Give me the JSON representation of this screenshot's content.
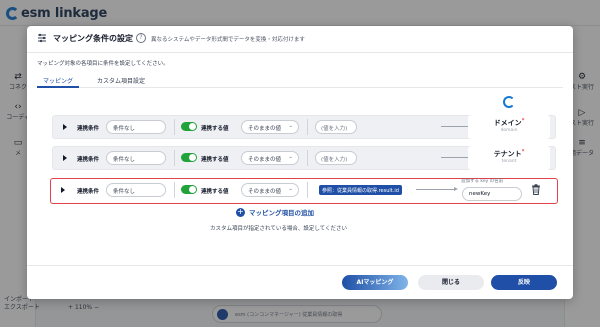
{
  "app": {
    "logo_text": "esm linkage",
    "back_label": "Se",
    "left_panel": [
      {
        "label": "コネク",
        "icon": "link-icon"
      },
      {
        "label": "コーディ",
        "icon": "code-icon"
      },
      {
        "label": "メ",
        "icon": "message-icon"
      }
    ],
    "right_panel": [
      {
        "label": "スト実行",
        "icon": "gear-icon"
      },
      {
        "label": "スト実行",
        "icon": "play-icon"
      },
      {
        "label": "用データ",
        "icon": "database-icon"
      }
    ],
    "bottom_left": [
      "インポート",
      "エクスポート"
    ],
    "zoom": "110%",
    "bg_node_text": "esm (コンコンマネージャー) 従業員情報の取得"
  },
  "modal": {
    "title": "マッピング条件の設定",
    "subtitle": "異なるシステムやデータ形式間でデータを変換・対応付けます",
    "description": "マッピング対象の各項目に条件を設定してください。",
    "tabs": [
      {
        "label": "マッピング",
        "active": true
      },
      {
        "label": "カスタム項目設定",
        "active": false
      }
    ],
    "rows": [
      {
        "condition_label": "連携条件",
        "condition_value": "条件なし",
        "toggle_on": true,
        "value_label": "連携する値",
        "value_type": "そのままの値",
        "value_placeholder": "(値を入力)",
        "target": "ドメイン",
        "target_sub": "domain"
      },
      {
        "condition_label": "連携条件",
        "condition_value": "条件なし",
        "toggle_on": true,
        "value_label": "連携する値",
        "value_type": "そのままの値",
        "value_placeholder": "(値を入力)",
        "target": "テナント",
        "target_sub": "tenant"
      },
      {
        "condition_label": "連携条件",
        "condition_value": "条件なし",
        "toggle_on": true,
        "value_label": "連携する値",
        "value_type": "そのままの値",
        "value_chip": "参照：従業員情報の取得.result.id",
        "key_label": "追加する key の名前",
        "key_value": "newKey"
      }
    ],
    "add_mapping_label": "マッピング項目の追加",
    "hint": "カスタム項目が指定されている場合、設定してください",
    "buttons": {
      "ai": "AIマッピング",
      "close": "閉じる",
      "apply": "反映"
    }
  },
  "colors": {
    "accent": "#1f4fa6",
    "toggle_on": "#22a33a",
    "selected_border": "#e2424b"
  }
}
